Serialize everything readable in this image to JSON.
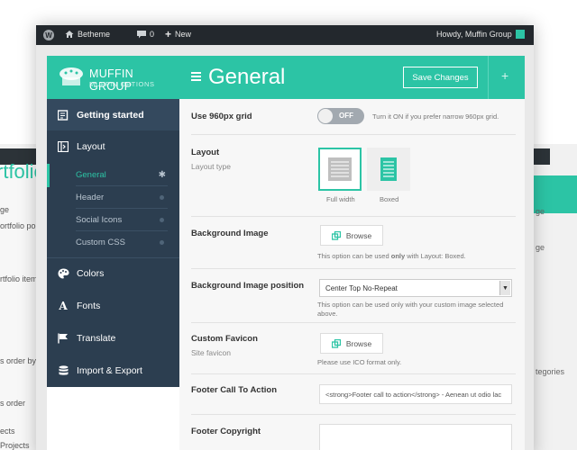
{
  "background_window": {
    "title": "rtfolio",
    "side_texts": [
      "ge",
      "ortfolio po",
      "rtfolio item",
      "s order by",
      "s order",
      "ects",
      "Projects"
    ],
    "right_texts": [
      "ge",
      "tegories"
    ]
  },
  "adminbar": {
    "site_name": "Betheme",
    "comments_count": "0",
    "new_label": "New",
    "greeting": "Howdy, Muffin Group"
  },
  "brand": {
    "name": "MUFFIN GROUP",
    "subtitle": "MUFFIN OPTIONS"
  },
  "sidebar": {
    "items": [
      {
        "label": "Getting started",
        "icon": "edit-icon"
      },
      {
        "label": "Layout",
        "icon": "layout-icon"
      },
      {
        "label": "Colors",
        "icon": "palette-icon"
      },
      {
        "label": "Fonts",
        "icon": "font-icon"
      },
      {
        "label": "Translate",
        "icon": "flag-icon"
      },
      {
        "label": "Import & Export",
        "icon": "database-icon"
      }
    ],
    "subitems": [
      {
        "label": "General",
        "active": true
      },
      {
        "label": "Header",
        "active": false
      },
      {
        "label": "Social Icons",
        "active": false
      },
      {
        "label": "Custom CSS",
        "active": false
      }
    ]
  },
  "header": {
    "title": "General",
    "save_label": "Save Changes",
    "plus": "+"
  },
  "fields": {
    "grid960": {
      "label": "Use 960px grid",
      "toggle_text": "OFF",
      "desc": "Turn it ON if you prefer narrow 960px grid."
    },
    "layout": {
      "label": "Layout",
      "sublabel": "Layout type",
      "options": [
        "Full width",
        "Boxed"
      ],
      "selected": "Full width"
    },
    "bg_image": {
      "label": "Background Image",
      "browse": "Browse",
      "desc_pre": "This option can be used ",
      "desc_bold": "only",
      "desc_post": " with Layout: Boxed."
    },
    "bg_position": {
      "label": "Background Image position",
      "value": "Center Top No-Repeat",
      "desc": "This option can be used only with your custom image selected above."
    },
    "favicon": {
      "label": "Custom Favicon",
      "sublabel": "Site favicon",
      "browse": "Browse",
      "desc": "Please use ICO format only."
    },
    "footer_cta": {
      "label": "Footer Call To Action",
      "value": "<strong>Footer call to action</strong> - Aenean ut odio lac"
    },
    "footer_copyright": {
      "label": "Footer Copyright",
      "value": ""
    }
  },
  "colors": {
    "accent": "#2cc4a5",
    "sidebar_bg": "#2c3e50",
    "adminbar_bg": "#23282d"
  }
}
